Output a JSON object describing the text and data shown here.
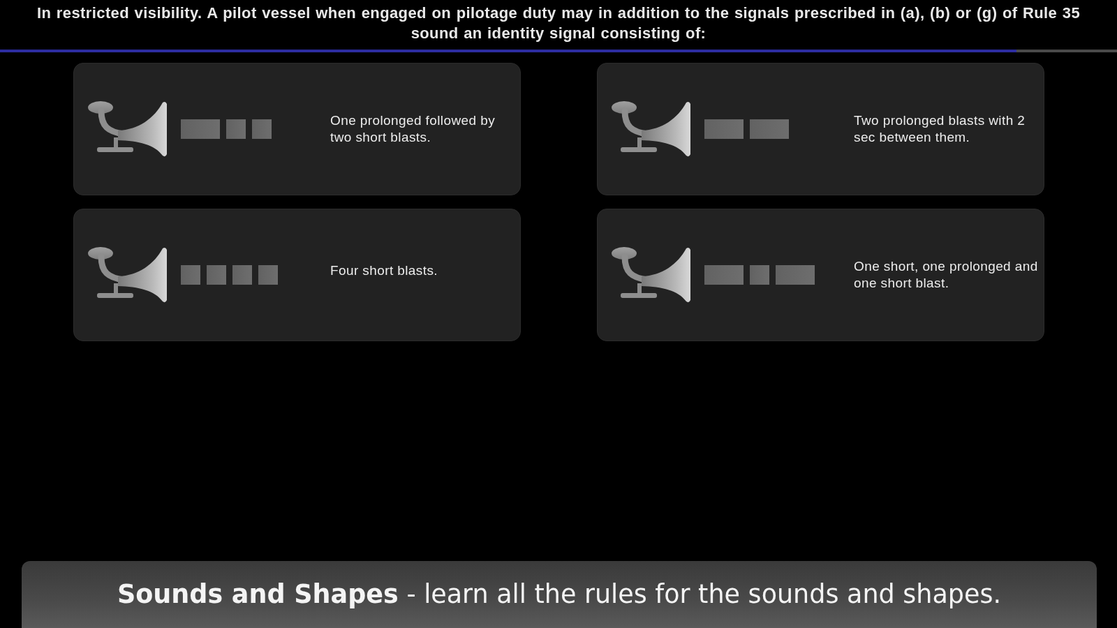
{
  "question": {
    "text": "In restricted visibility. A pilot vessel when engaged on pilotage duty may in addition to the signals prescribed in (a), (b) or (g) of Rule 35 sound an identity signal consisting of:"
  },
  "progress": {
    "level": 0.91
  },
  "answers": [
    {
      "blasts": [
        {
          "kind": "prolonged"
        },
        {
          "kind": "short"
        },
        {
          "kind": "short"
        }
      ],
      "text": "One prolonged followed by two short blasts."
    },
    {
      "blasts": [
        {
          "kind": "prolonged"
        },
        {
          "kind": "prolonged"
        }
      ],
      "text": "Two prolonged blasts with 2 sec between them."
    },
    {
      "blasts": [
        {
          "kind": "short"
        },
        {
          "kind": "short"
        },
        {
          "kind": "short"
        },
        {
          "kind": "short"
        }
      ],
      "text": "Four short blasts."
    },
    {
      "blasts": [
        {
          "kind": "prolonged"
        },
        {
          "kind": "short"
        },
        {
          "kind": "prolonged"
        }
      ],
      "text": "One short, one prolonged and one short blast."
    }
  ],
  "banner": {
    "text": "**Sounds and Shapes** - learn all the rules for the sounds and shapes."
  }
}
